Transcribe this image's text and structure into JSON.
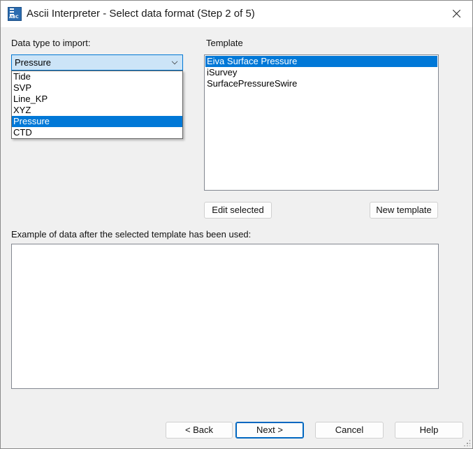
{
  "window": {
    "title": "Ascii Interpreter - Select data format (Step 2 of 5)",
    "app_icon": "abc-icon",
    "app_icon_text": "ABC"
  },
  "data_type": {
    "label": "Data type to import:",
    "selected": "Pressure",
    "options": [
      "Tide",
      "SVP",
      "Line_KP",
      "XYZ",
      "Pressure",
      "CTD"
    ],
    "selected_index": 4
  },
  "template": {
    "label": "Template",
    "items": [
      "Eiva Surface Pressure",
      "iSurvey",
      "SurfacePressureSwire"
    ],
    "selected_index": 0,
    "edit_button": "Edit selected",
    "new_button": "New template"
  },
  "preview": {
    "label": "Example of data after the selected template has been used:"
  },
  "footer": {
    "back": "< Back",
    "next": "Next >",
    "cancel": "Cancel",
    "help": "Help"
  },
  "colors": {
    "selection": "#0078d7",
    "combo_bg": "#cce4f7",
    "accent_border": "#0078d4"
  }
}
